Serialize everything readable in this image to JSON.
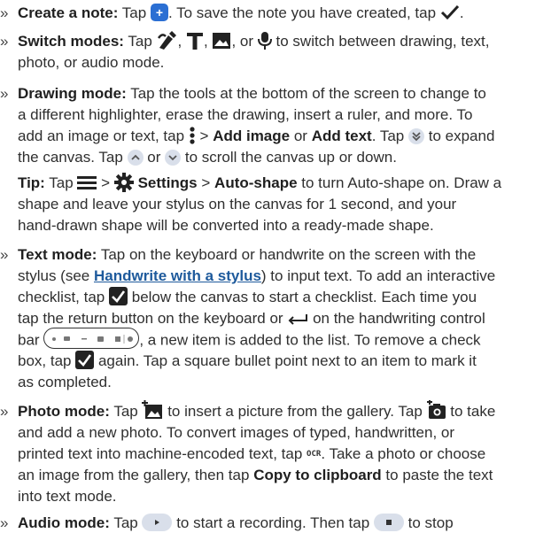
{
  "sections": {
    "create_note": {
      "title": "Create a note:",
      "l1a": "Tap",
      "l1b": ". To save the note you have created, tap",
      "l1c": "."
    },
    "switch_modes": {
      "title": "Switch modes:",
      "l1a": "Tap",
      "l1b": ",",
      "l1c": ",",
      "l1d": ", or",
      "l1e": "to switch between drawing, text,",
      "l2": "photo, or audio mode."
    },
    "drawing_mode": {
      "title": "Drawing mode:",
      "l1": "Tap the tools at the bottom of the screen to change to",
      "l2": "a different highlighter, erase the drawing, insert a ruler, and more. To",
      "l3a": "add an image or text, tap",
      "l3b": ">",
      "l3c": "Add image",
      "l3d": "or",
      "l3e": "Add text",
      "l3f": ". Tap",
      "l3g": "to expand",
      "l4a": "the canvas. Tap",
      "l4b": "or",
      "l4c": "to scroll the canvas up or down."
    },
    "tip": {
      "title": "Tip:",
      "l1a": "Tap",
      "l1b": ">",
      "l1c": "Settings",
      "l1d": ">",
      "l1e": "Auto-shape",
      "l1f": "to turn Auto-shape on. Draw a",
      "l2": "shape and leave your stylus on the canvas for 1 second, and your",
      "l3": "hand-drawn shape will be converted into a ready-made shape."
    },
    "text_mode": {
      "title": "Text mode:",
      "l1": "Tap on the keyboard or handwrite on the screen with the",
      "l2a": "stylus (see",
      "l2_link": "Handwrite with a stylus",
      "l2b": ") to input text. To add an interactive",
      "l3a": "checklist, tap",
      "l3b": "below the canvas to start a checklist. Each time you",
      "l4a": "tap the return button on the keyboard or",
      "l4b": "on the handwriting control",
      "l5a": "bar",
      "l5b": ", a new item is added to the list. To remove a check",
      "l6a": "box, tap",
      "l6b": "again. Tap a square bullet point next to an item to mark it",
      "l7": "as completed."
    },
    "photo_mode": {
      "title": "Photo mode:",
      "l1a": "Tap",
      "l1b": "to insert a picture from the gallery. Tap",
      "l1c": "to take",
      "l2": "and add a new photo. To convert images of typed, handwritten, or",
      "l3a": "printed text into machine-encoded text, tap",
      "l3_ocr": "OCR",
      "l3b": ". Take a photo or choose",
      "l4": "an image from the gallery, then tap",
      "l4b": "Copy to clipboard",
      "l4c": "to paste the text",
      "l5": "into text mode."
    },
    "audio_mode": {
      "title": "Audio mode:",
      "l1a": "Tap",
      "l1b": "to start a recording. Then tap",
      "l1c": "to stop"
    }
  },
  "bullet": "»",
  "icons": [
    "plus-square-icon",
    "checkmark-icon",
    "pen-icon",
    "text-t-icon",
    "image-icon",
    "microphone-icon",
    "more-vert-icon",
    "expand-icon",
    "scroll-up-icon",
    "scroll-down-icon",
    "menu-icon",
    "gear-icon",
    "checkbox-icon",
    "return-icon",
    "handwriting-bar-icon",
    "gallery-add-icon",
    "camera-add-icon",
    "play-icon",
    "stop-icon"
  ],
  "colors": {
    "accent_blue": "#2b6fd3",
    "link": "#1e5a9c",
    "text": "#2f2f2f",
    "button_bg": "#d9dfea"
  }
}
